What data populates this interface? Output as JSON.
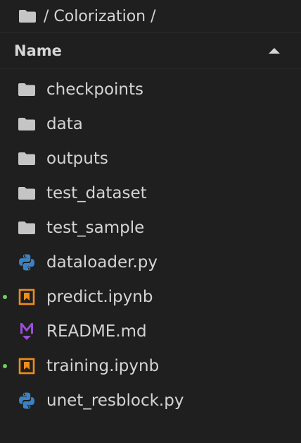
{
  "breadcrumb": {
    "text": "/ Colorization /"
  },
  "header": {
    "name_label": "Name"
  },
  "colors": {
    "folder": "#c5c5c5",
    "python_blue": "#3b82c4",
    "python_yellow": "#3b82c4",
    "notebook": "#f08c1a",
    "markdown": "#9c4fd8",
    "modified_dot": "#6fcf5a"
  },
  "files": [
    {
      "name": "checkpoints",
      "icon": "folder-icon"
    },
    {
      "name": "data",
      "icon": "folder-icon"
    },
    {
      "name": "outputs",
      "icon": "folder-icon"
    },
    {
      "name": "test_dataset",
      "icon": "folder-icon"
    },
    {
      "name": "test_sample",
      "icon": "folder-icon"
    },
    {
      "name": "dataloader.py",
      "icon": "python-icon"
    },
    {
      "name": "predict.ipynb",
      "icon": "notebook-icon",
      "modified": true
    },
    {
      "name": "README.md",
      "icon": "markdown-icon"
    },
    {
      "name": "training.ipynb",
      "icon": "notebook-icon",
      "modified": true
    },
    {
      "name": "unet_resblock.py",
      "icon": "python-icon"
    }
  ]
}
